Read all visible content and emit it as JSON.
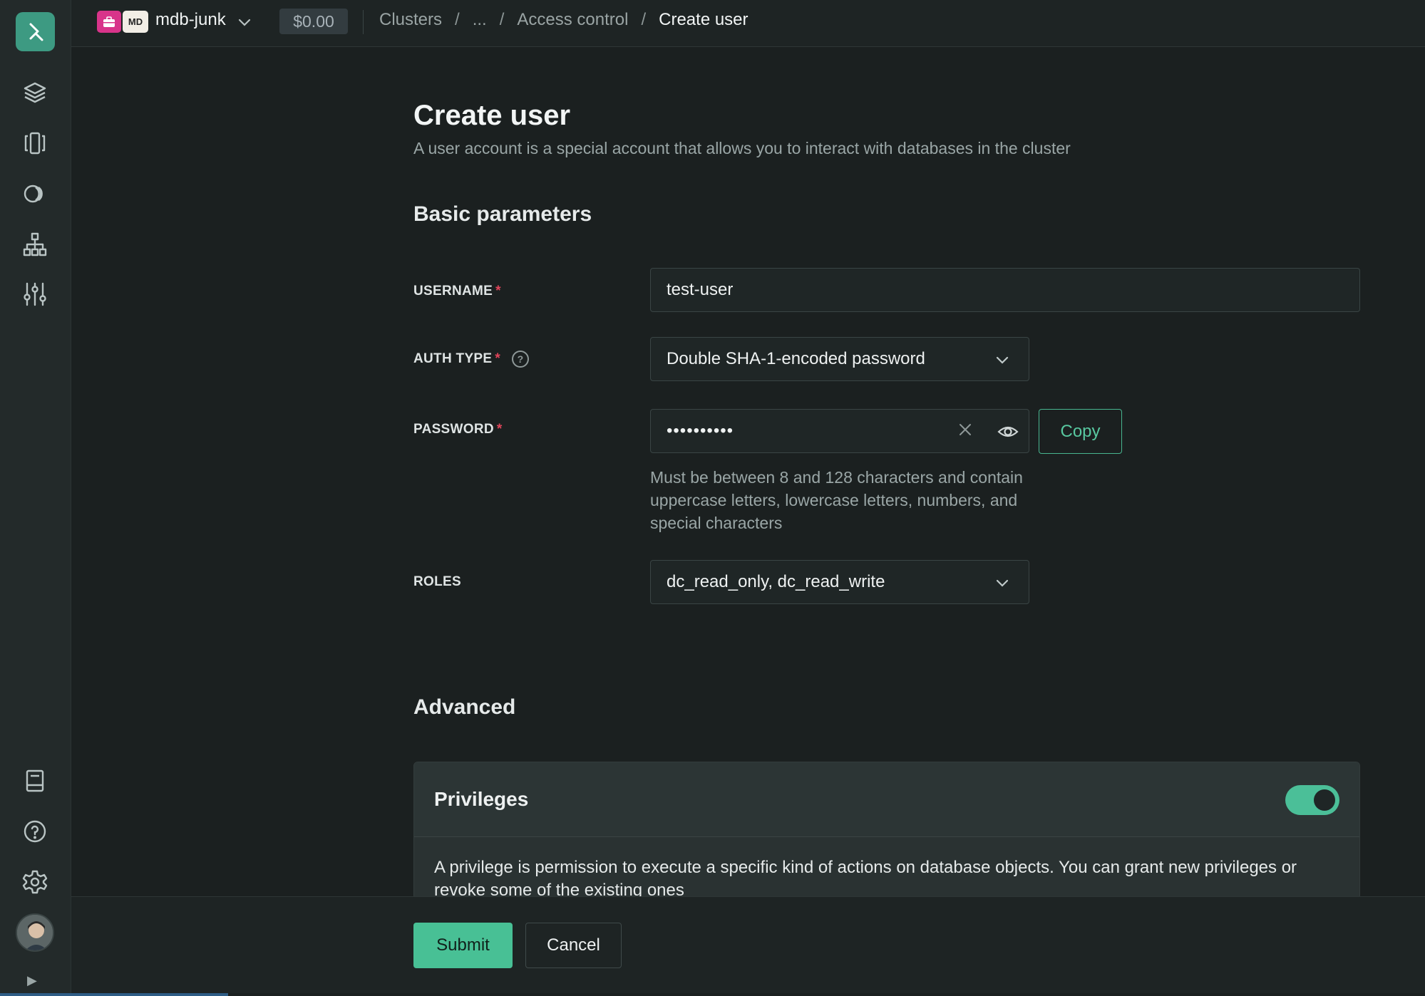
{
  "header": {
    "project_badge": "MD",
    "project_name": "mdb-junk",
    "balance": "$0.00",
    "breadcrumbs": [
      "Clusters",
      "...",
      "Access control",
      "Create user"
    ],
    "separator": "/"
  },
  "sidebar": {
    "items": [
      "logo-icon",
      "layers-icon",
      "columns-icon",
      "database-icon",
      "hierarchy-icon",
      "sliders-icon",
      "book-icon",
      "help-icon",
      "gear-icon"
    ],
    "expand_glyph": "▶"
  },
  "page": {
    "title": "Create user",
    "subtitle": "A user account is a special account that allows you to interact with databases in the cluster"
  },
  "basic": {
    "title": "Basic parameters",
    "username_label": "USERNAME",
    "username_value": "test-user",
    "auth_label": "AUTH TYPE",
    "auth_value": "Double SHA-1-encoded password",
    "password_label": "PASSWORD",
    "password_value": "••••••••••",
    "copy_label": "Copy",
    "password_hint": "Must be between 8 and 128 characters and contain uppercase letters, lowercase letters, numbers, and special characters",
    "roles_label": "ROLES",
    "roles_value": "dc_read_only, dc_read_write",
    "required_mark": "*"
  },
  "advanced": {
    "title": "Advanced",
    "privileges_title": "Privileges",
    "privileges_enabled": true,
    "privileges_text": "A privilege is permission to execute a specific kind of actions on database objects. You can grant new privileges or revoke some of the existing ones"
  },
  "footer": {
    "submit_label": "Submit",
    "cancel_label": "Cancel"
  },
  "colors": {
    "accent": "#48c095",
    "required": "#e0455a",
    "project_badge": "#d8348a"
  }
}
